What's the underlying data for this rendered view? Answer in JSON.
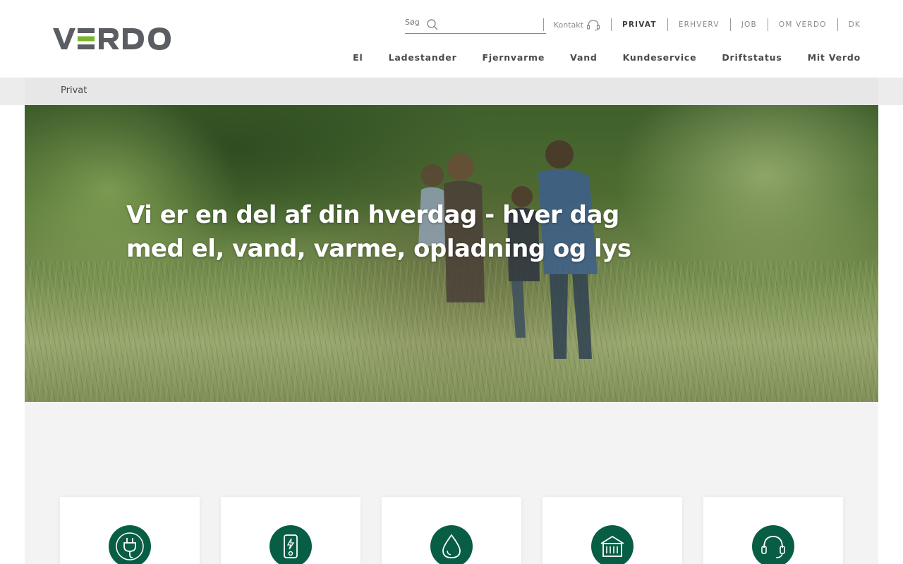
{
  "brand": {
    "name": "VERDO",
    "primary_color": "#5a5e62",
    "accent_color": "#7ab527",
    "service_green": "#075e45"
  },
  "search": {
    "placeholder": "Søg"
  },
  "top_nav": {
    "contact_label": "Kontakt",
    "links": [
      "PRIVAT",
      "ERHVERV",
      "JOB",
      "OM VERDO",
      "DK"
    ],
    "active": "PRIVAT"
  },
  "main_nav": [
    "El",
    "Ladestander",
    "Fjernvarme",
    "Vand",
    "Kundeservice",
    "Driftstatus",
    "Mit Verdo"
  ],
  "breadcrumb": "Privat",
  "hero": {
    "title_line1": "Vi er en del af din hverdag - hver dag",
    "title_line2": "med el, vand, varme, opladning og lys"
  },
  "service_cards": [
    {
      "icon": "plug-icon"
    },
    {
      "icon": "charger-icon"
    },
    {
      "icon": "water-drop-icon"
    },
    {
      "icon": "heating-unit-icon"
    },
    {
      "icon": "headset-icon"
    }
  ]
}
